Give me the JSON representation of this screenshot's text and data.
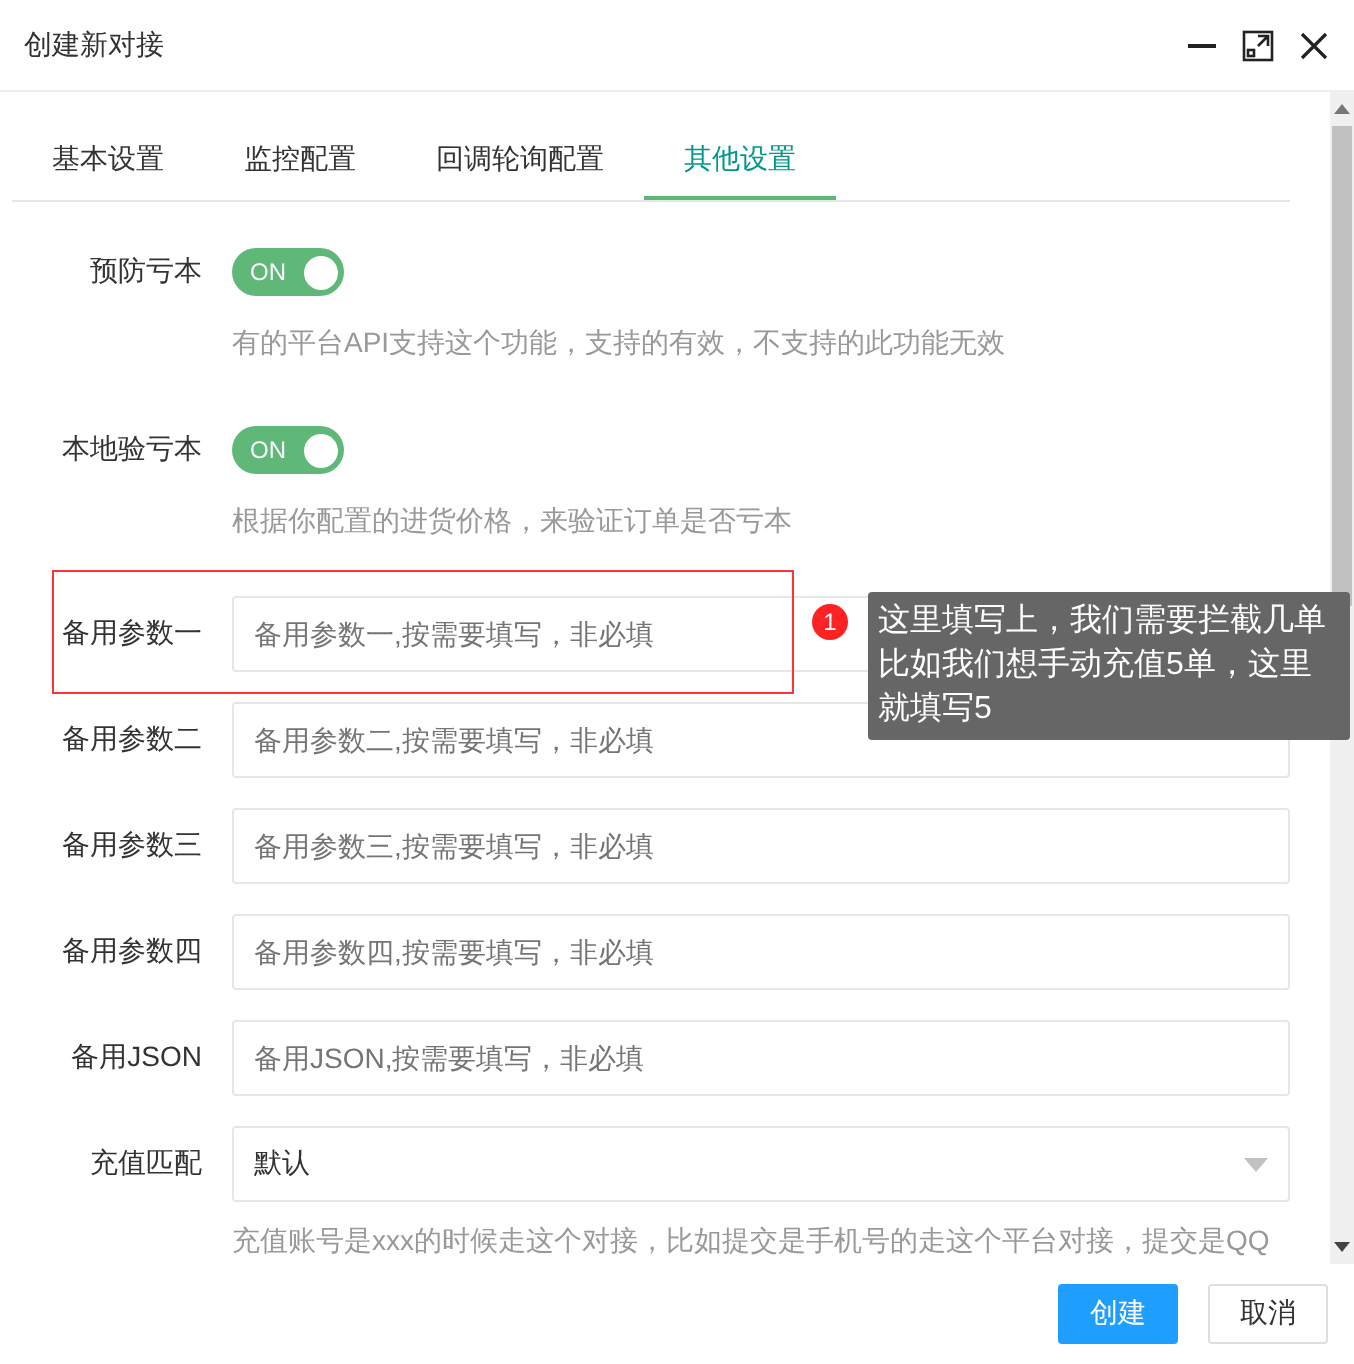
{
  "window": {
    "title": "创建新对接"
  },
  "tabs": [
    {
      "label": "基本设置",
      "selected": false
    },
    {
      "label": "监控配置",
      "selected": false
    },
    {
      "label": "回调轮询配置",
      "selected": false
    },
    {
      "label": "其他设置",
      "selected": true
    }
  ],
  "fields": [
    {
      "kind": "toggle",
      "label": "预防亏本",
      "on": true,
      "on_text": "ON",
      "hint": "有的平台API支持这个功能，支持的有效，不支持的此功能无效"
    },
    {
      "kind": "toggle",
      "label": "本地验亏本",
      "on": true,
      "on_text": "ON",
      "hint": "根据你配置的进货价格，来验证订单是否亏本"
    },
    {
      "kind": "input",
      "label": "备用参数一",
      "placeholder": "备用参数一,按需要填写，非必填",
      "highlighted": true
    },
    {
      "kind": "input",
      "label": "备用参数二",
      "placeholder": "备用参数二,按需要填写，非必填"
    },
    {
      "kind": "input",
      "label": "备用参数三",
      "placeholder": "备用参数三,按需要填写，非必填"
    },
    {
      "kind": "input",
      "label": "备用参数四",
      "placeholder": "备用参数四,按需要填写，非必填"
    },
    {
      "kind": "input",
      "label": "备用JSON",
      "placeholder": "备用JSON,按需要填写，非必填"
    },
    {
      "kind": "select",
      "label": "充值匹配",
      "value": "默认",
      "hint": "充值账号是xxx的时候走这个对接，比如提交是手机号的走这个平台对接，提交是QQ"
    }
  ],
  "annotation": {
    "number": "1",
    "text": "这里填写上，我们需要拦截几单比如我们想手动充值5单，这里就填写5"
  },
  "buttons": [
    {
      "label": "创建",
      "kind": "primary"
    },
    {
      "label": "取消",
      "kind": "default"
    }
  ]
}
